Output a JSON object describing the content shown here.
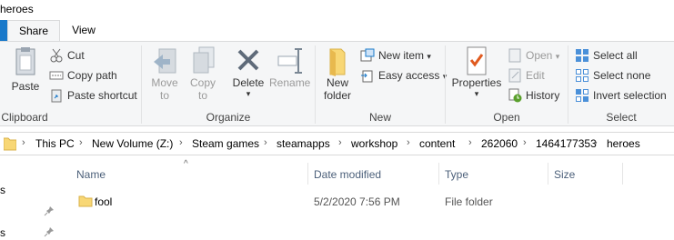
{
  "window": {
    "title": "heroes"
  },
  "tabs": [
    {
      "label": "Share"
    },
    {
      "label": "View"
    }
  ],
  "ribbon": {
    "clipboard": {
      "group_label": "Clipboard",
      "paste": "Paste",
      "cut": "Cut",
      "copy_path": "Copy path",
      "paste_shortcut": "Paste shortcut"
    },
    "organize": {
      "group_label": "Organize",
      "move_to": "Move",
      "move_to_2": "to",
      "copy_to": "Copy",
      "copy_to_2": "to",
      "delete": "Delete",
      "rename": "Rename"
    },
    "new": {
      "group_label": "New",
      "new_folder": "New",
      "new_folder_2": "folder",
      "new_item": "New item",
      "easy_access": "Easy access"
    },
    "open": {
      "group_label": "Open",
      "properties": "Properties",
      "open": "Open",
      "edit": "Edit",
      "history": "History"
    },
    "select": {
      "group_label": "Select",
      "select_all": "Select all",
      "select_none": "Select none",
      "invert_selection": "Invert selection"
    }
  },
  "address": {
    "crumbs": [
      "This PC",
      "New Volume (Z:)",
      "Steam games",
      "steamapps",
      "workshop",
      "content",
      "262060",
      "1464177353",
      "heroes"
    ]
  },
  "nav": {
    "item1": "s",
    "item2": "s"
  },
  "columns": {
    "name": "Name",
    "date": "Date modified",
    "type": "Type",
    "size": "Size"
  },
  "rows": [
    {
      "name": "fool",
      "date": "5/2/2020 7:56 PM",
      "type": "File folder",
      "size": ""
    }
  ],
  "colors": {
    "accent": "#1979ca",
    "folder": "#f8d775",
    "ribbon_bg": "#f5f6f7"
  }
}
